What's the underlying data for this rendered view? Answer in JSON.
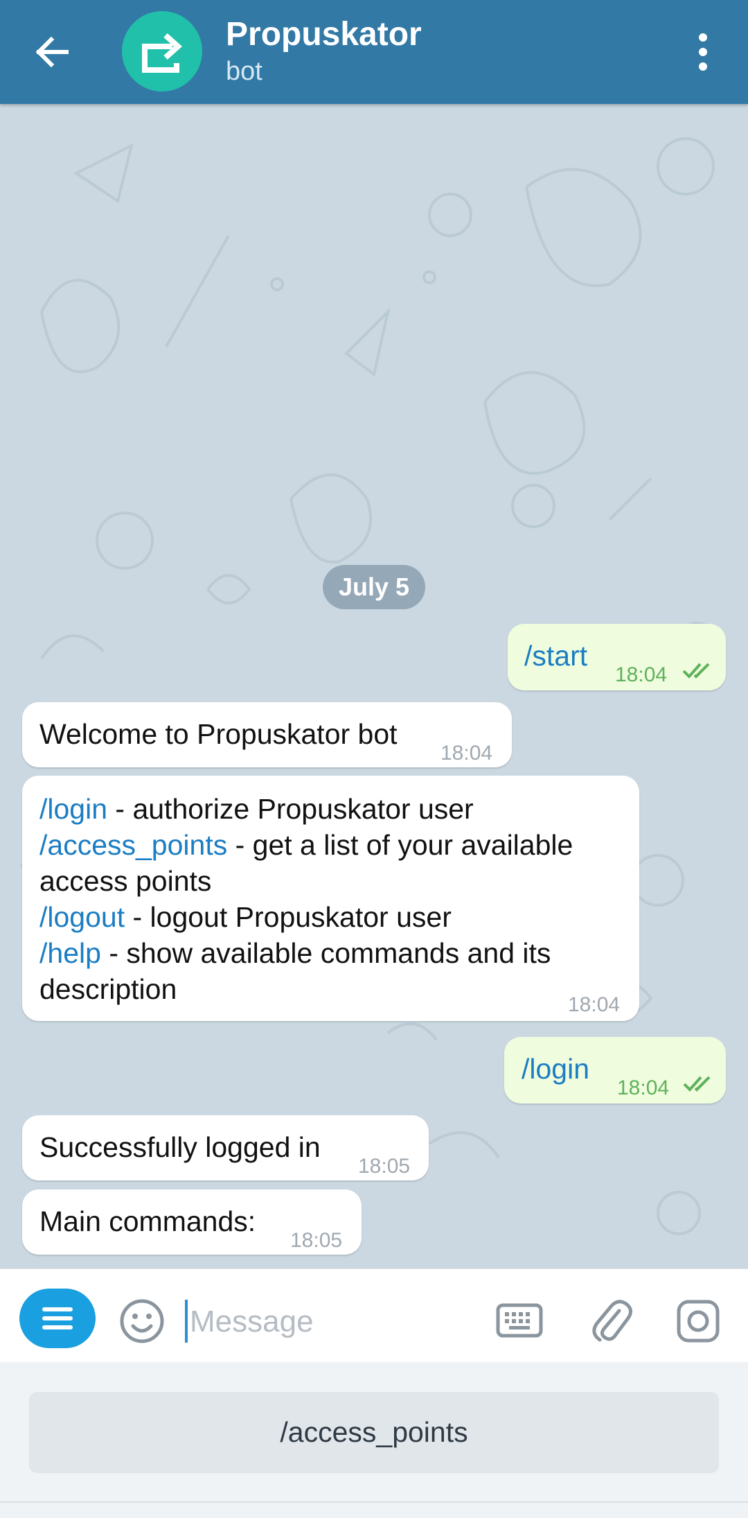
{
  "header": {
    "title": "Propuskator",
    "subtitle": "bot",
    "bg_color": "#3279a5",
    "avatar_color": "#21c0aa",
    "back_icon": "arrow-left-icon",
    "menu_icon": "more-vert-icon"
  },
  "chat": {
    "date": "July 5",
    "messages": [
      {
        "dir": "out",
        "cmd": "/start",
        "time": "18:04",
        "status": "read"
      },
      {
        "dir": "in",
        "text": "Welcome to Propuskator bot",
        "time": "18:04"
      },
      {
        "dir": "in",
        "lines": [
          {
            "cmd": "/login",
            "text": " - authorize Propuskator user"
          },
          {
            "cmd": "/access_points",
            "text": " - get a list of your available access points"
          },
          {
            "cmd": "/logout",
            "text": " - logout Propuskator user"
          },
          {
            "cmd": "/help",
            "text": " - show available commands and its description"
          }
        ],
        "time": "18:04"
      },
      {
        "dir": "out",
        "cmd": "/login",
        "time": "18:04",
        "status": "read"
      },
      {
        "dir": "in",
        "text": "Successfully logged in",
        "time": "18:05"
      },
      {
        "dir": "in",
        "text": "Main commands:",
        "time": "18:05"
      }
    ]
  },
  "input": {
    "placeholder": "Message",
    "value": "",
    "icons": [
      "menu-icon",
      "emoji-icon",
      "keyboard-icon",
      "attach-icon",
      "camera-icon"
    ]
  },
  "bot_keyboard": {
    "buttons": [
      "/access_points"
    ]
  },
  "colors": {
    "link": "#1b7dc3",
    "outgoing_bubble": "#effdde",
    "read_check": "#5fb15a",
    "accent": "#1a9fe0"
  }
}
